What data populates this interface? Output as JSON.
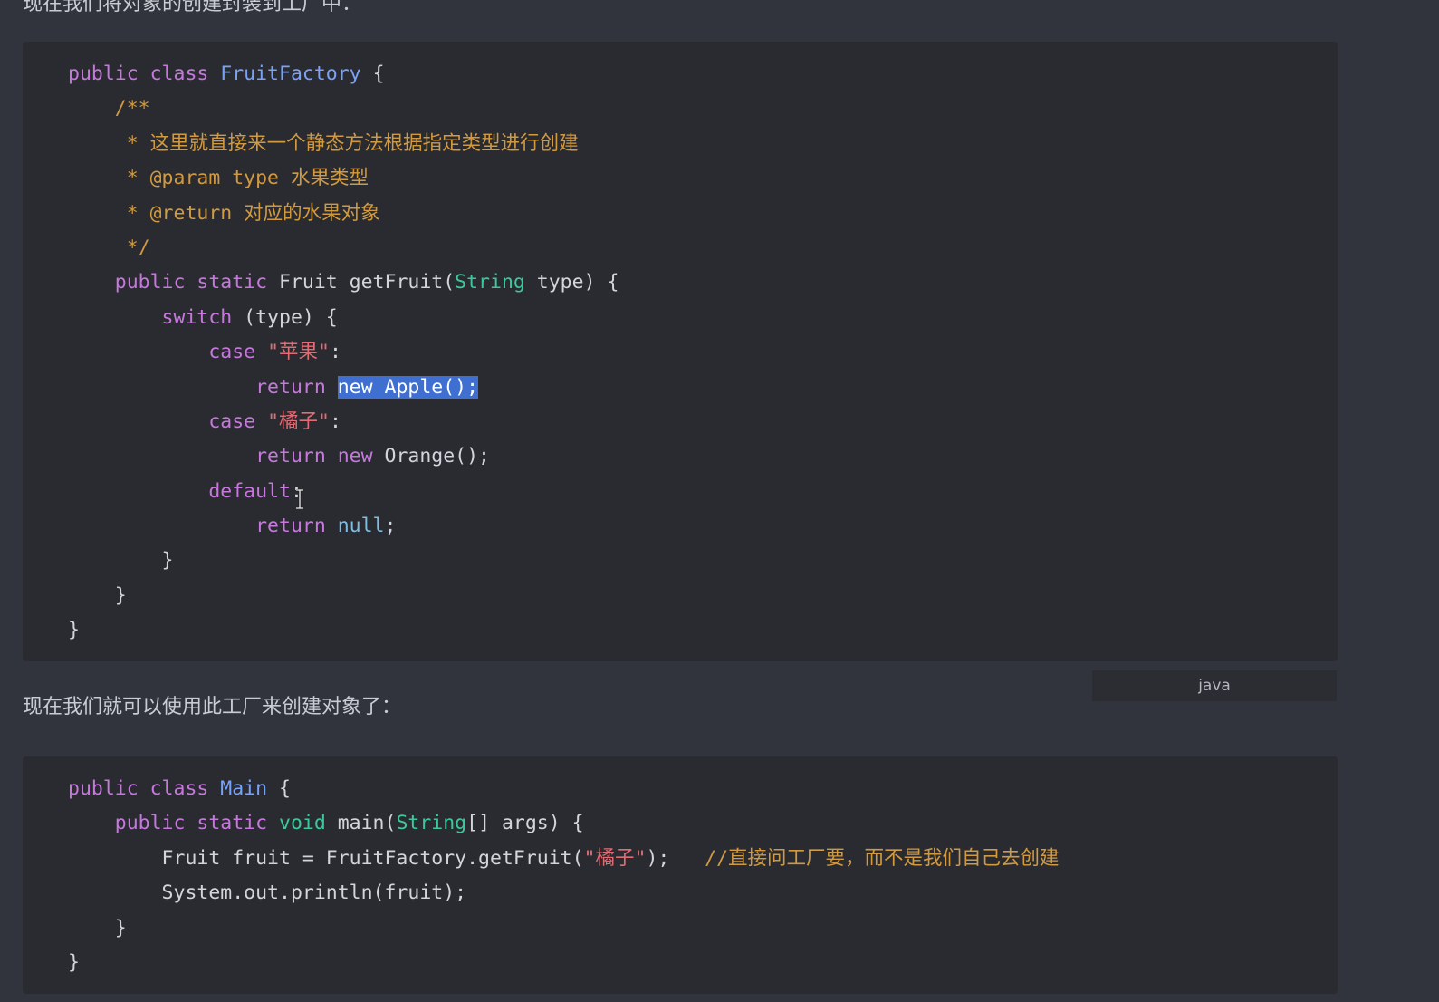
{
  "top_text": "现在我们将对象的创建封装到工厂中：",
  "code_block_1": {
    "lines": [
      [
        {
          "t": "public class ",
          "c": "kw"
        },
        {
          "t": "FruitFactory",
          "c": "cls"
        },
        {
          "t": " {",
          "c": ""
        }
      ],
      [
        {
          "t": "    /**",
          "c": "cmt"
        }
      ],
      [
        {
          "t": "     * 这里就直接来一个静态方法根据指定类型进行创建",
          "c": "cmt"
        }
      ],
      [
        {
          "t": "     * @param type 水果类型",
          "c": "cmt"
        }
      ],
      [
        {
          "t": "     * @return 对应的水果对象",
          "c": "cmt"
        }
      ],
      [
        {
          "t": "     */",
          "c": "cmt"
        }
      ],
      [
        {
          "t": "    public static ",
          "c": "kw"
        },
        {
          "t": "Fruit getFruit(",
          "c": ""
        },
        {
          "t": "String",
          "c": "type"
        },
        {
          "t": " type) {",
          "c": ""
        }
      ],
      [
        {
          "t": "        switch",
          "c": "kw"
        },
        {
          "t": " (type) {",
          "c": ""
        }
      ],
      [
        {
          "t": "            case ",
          "c": "kw"
        },
        {
          "t": "\"苹果\"",
          "c": "str"
        },
        {
          "t": ":",
          "c": ""
        }
      ],
      [
        {
          "t": "                return ",
          "c": "kw"
        },
        {
          "t": "new Apple();",
          "c": "selected"
        }
      ],
      [
        {
          "t": "            case ",
          "c": "kw"
        },
        {
          "t": "\"橘子\"",
          "c": "str"
        },
        {
          "t": ":",
          "c": ""
        }
      ],
      [
        {
          "t": "                return new ",
          "c": "kw"
        },
        {
          "t": "Orange();",
          "c": ""
        }
      ],
      [
        {
          "t": "            default",
          "c": "kw"
        },
        {
          "t": ":",
          "c": ""
        }
      ],
      [
        {
          "t": "                return ",
          "c": "kw"
        },
        {
          "t": "null",
          "c": "num"
        },
        {
          "t": ";",
          "c": ""
        }
      ],
      [
        {
          "t": "        }",
          "c": ""
        }
      ],
      [
        {
          "t": "    }",
          "c": ""
        }
      ],
      [
        {
          "t": "}",
          "c": ""
        }
      ]
    ]
  },
  "language_label": "java",
  "prose_text": "现在我们就可以使用此工厂来创建对象了：",
  "code_block_2": {
    "lines": [
      [
        {
          "t": "public class ",
          "c": "kw"
        },
        {
          "t": "Main",
          "c": "cls"
        },
        {
          "t": " {",
          "c": ""
        }
      ],
      [
        {
          "t": "    public static ",
          "c": "kw"
        },
        {
          "t": "void",
          "c": "type"
        },
        {
          "t": " main(",
          "c": ""
        },
        {
          "t": "String",
          "c": "type"
        },
        {
          "t": "[] args) {",
          "c": ""
        }
      ],
      [
        {
          "t": "        Fruit fruit = FruitFactory.getFruit(",
          "c": ""
        },
        {
          "t": "\"橘子\"",
          "c": "str"
        },
        {
          "t": ");   ",
          "c": ""
        },
        {
          "t": "//直接问工厂要，而不是我们自己去创建",
          "c": "cmt"
        }
      ],
      [
        {
          "t": "        System.out.println(fruit);",
          "c": ""
        }
      ],
      [
        {
          "t": "    }",
          "c": ""
        }
      ],
      [
        {
          "t": "}",
          "c": ""
        }
      ]
    ]
  },
  "colors": {
    "keyword": "#c678dd",
    "class_name": "#7aa2f7",
    "type": "#3bc99b",
    "string": "#e06c75",
    "comment": "#d19a40",
    "literal": "#80bde0",
    "selection": "#3f6fd0",
    "page_background": "#32343d",
    "code_background": "#2a2b30"
  },
  "icons": {
    "cursor": "text-cursor-icon"
  }
}
